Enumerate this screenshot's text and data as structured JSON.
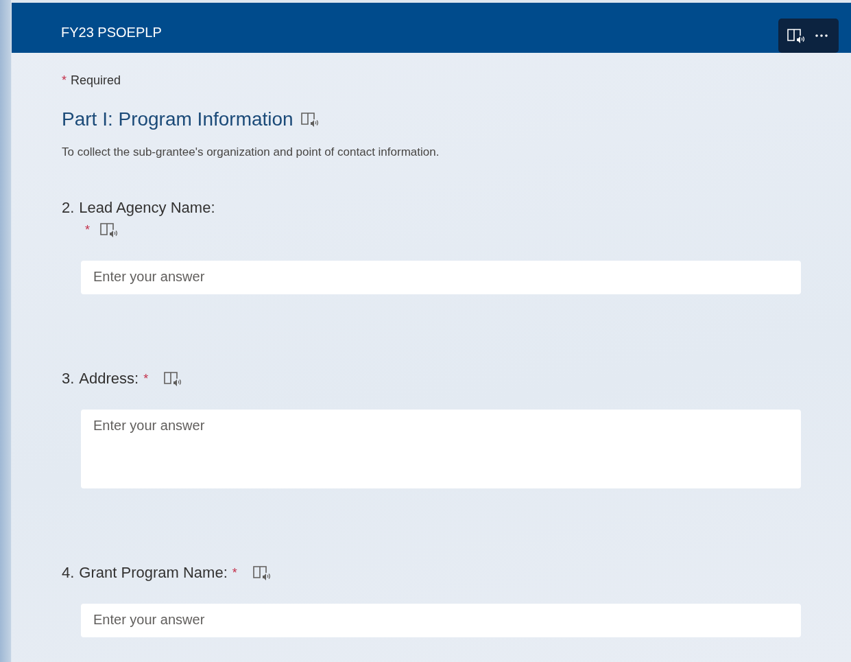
{
  "form": {
    "title": "FY23 PSOEPLP",
    "required_note": {
      "mark": "*",
      "text": "Required"
    },
    "section": {
      "title": "Part I: Program Information",
      "description": "To collect the sub-grantee's organization and point of contact information."
    },
    "questions": [
      {
        "number": "2.",
        "title": "Lead Agency Name:",
        "mark": "*",
        "kind": "wrapped",
        "multiline": false,
        "placeholder": "Enter your answer"
      },
      {
        "number": "3.",
        "title": "Address:",
        "mark": "*",
        "kind": "inline",
        "multiline": true,
        "placeholder": "Enter your answer"
      },
      {
        "number": "4.",
        "title": "Grant Program Name:",
        "mark": "*",
        "kind": "inline",
        "multiline": false,
        "placeholder": "Enter your answer"
      }
    ]
  }
}
